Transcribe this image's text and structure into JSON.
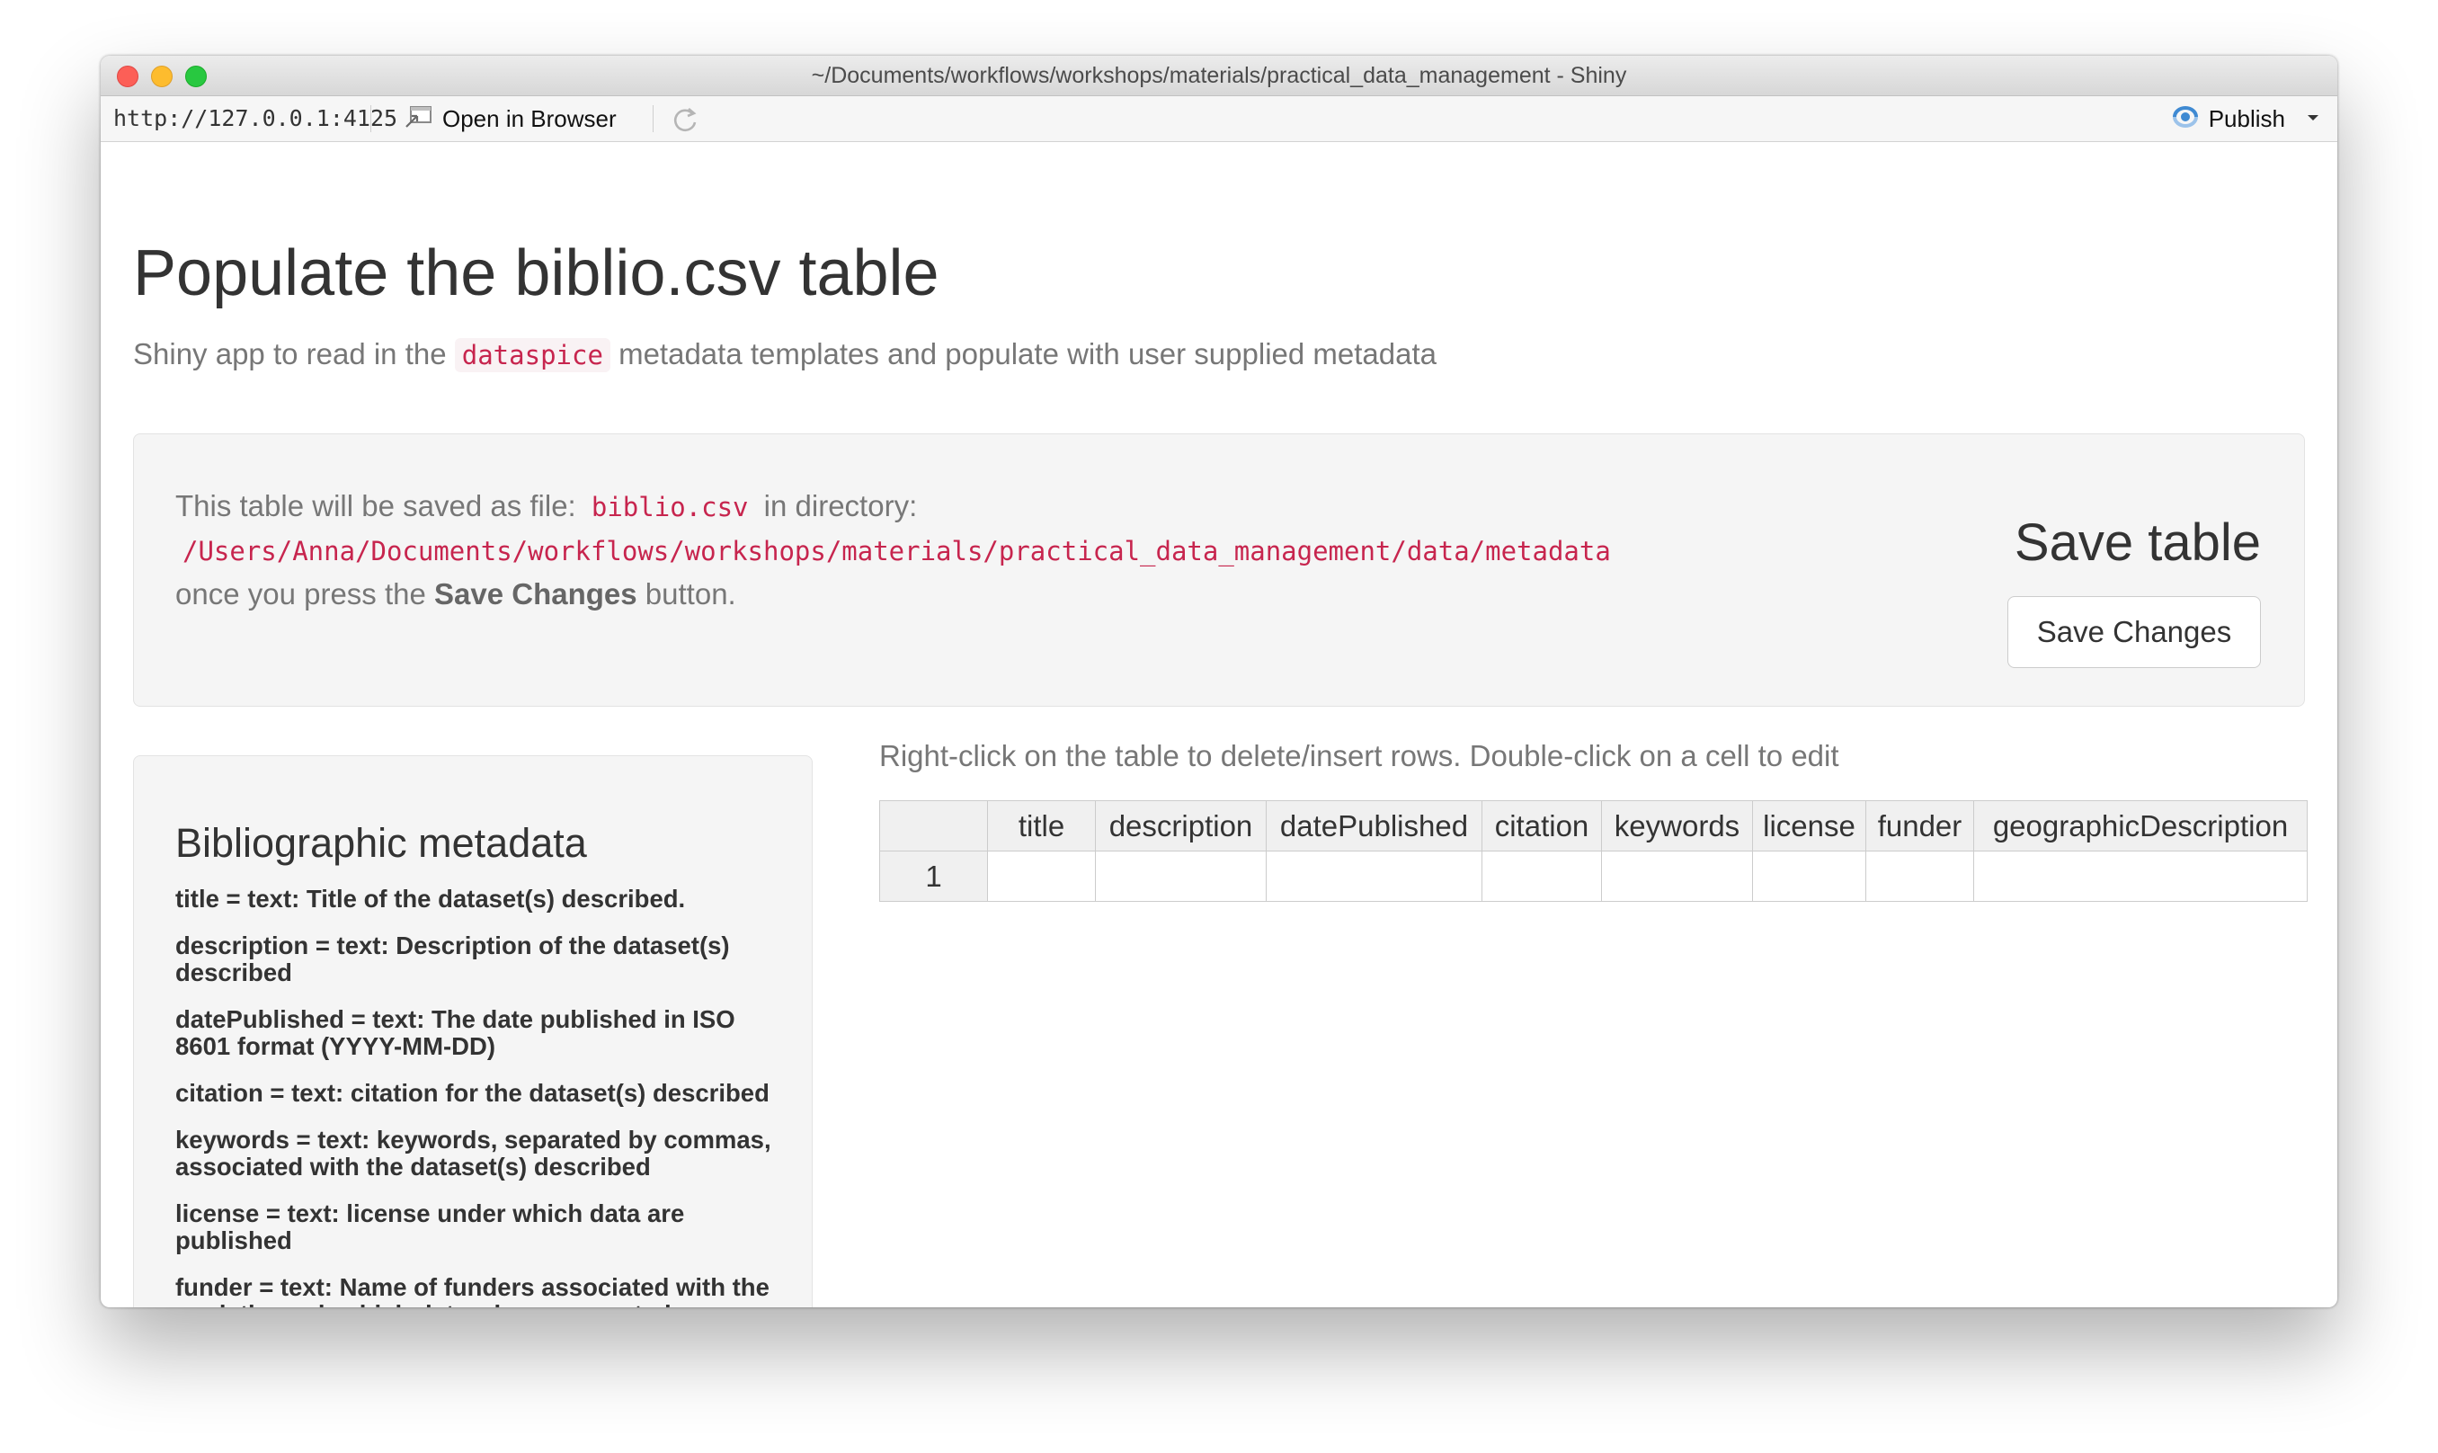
{
  "window": {
    "title": "~/Documents/workflows/workshops/materials/practical_data_management - Shiny"
  },
  "toolbar": {
    "url": "http://127.0.0.1:4125",
    "open_in_browser": "Open in Browser",
    "publish": "Publish"
  },
  "header": {
    "title": "Populate the biblio.csv table",
    "subtitle_pre": "Shiny app to read in the",
    "subtitle_code": "dataspice",
    "subtitle_post": "metadata templates and populate with user supplied metadata"
  },
  "info": {
    "line1_pre": "This table will be saved as file:",
    "file": "biblio.csv",
    "line1_post": "in directory:",
    "directory": "/Users/Anna/Documents/workflows/workshops/materials/practical_data_management/data/metadata",
    "line3_pre": "once you press the",
    "line3_bold": "Save Changes",
    "line3_post": "button.",
    "save_heading": "Save table",
    "save_button": "Save Changes"
  },
  "sidebar": {
    "title": "Bibliographic metadata",
    "definitions": [
      "title = text: Title of the dataset(s) described.",
      "description = text: Description of the dataset(s) described",
      "datePublished = text: The date published in ISO 8601 format (YYYY-MM-DD)",
      "citation = text: citation for the dataset(s) described",
      "keywords = text: keywords, separated by commas, associated with the dataset(s) described",
      "license = text: license under which data are published",
      "funder = text: Name of funders associated with the work through which data where generated"
    ]
  },
  "table": {
    "hint": "Right-click on the table to delete/insert rows. Double-click on a cell to edit",
    "columns": [
      "title",
      "description",
      "datePublished",
      "citation",
      "keywords",
      "license",
      "funder",
      "geographicDescription"
    ],
    "rows": [
      {
        "index": "1",
        "cells": [
          "",
          "",
          "",
          "",
          "",
          "",
          "",
          ""
        ]
      }
    ]
  },
  "colors": {
    "code_text": "#c7254e",
    "code_bg": "#f9f2f4",
    "publish_icon": "#3f8ad2"
  },
  "icons": {
    "open_in_browser": "open-in-browser-icon",
    "refresh": "refresh-icon",
    "publish": "publish-icon",
    "dropdown": "caret-down-icon"
  }
}
